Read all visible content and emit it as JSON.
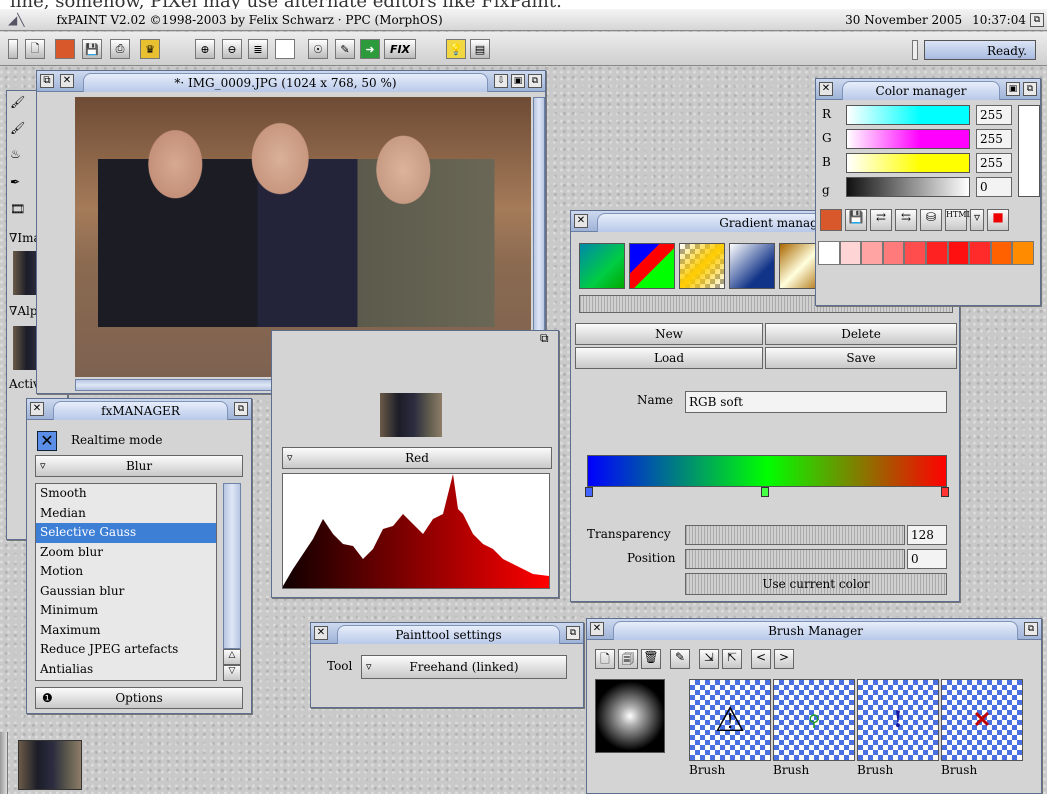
{
  "top_cut_text": "line, somehow, PiXel may use alternate editors like FixPaint.",
  "titlebar": {
    "title": "fxPAINT V2.02 ©1998-2003 by Felix Schwarz · PPC (MorphOS)",
    "date": "30 November 2005",
    "time": "10:37:04"
  },
  "toolbar": {
    "fix_label": "FIX",
    "status": "Ready."
  },
  "image_window": {
    "title": "*· IMG_0009.JPG (1024 x 768, 50 %)"
  },
  "left_tools": {
    "image_label": "∇Image",
    "alpha_label": "∇Alpha",
    "active_label": "Active"
  },
  "fxmanager": {
    "title": "fxMANAGER",
    "realtime_label": "Realtime mode",
    "category": "Blur",
    "effects": [
      "Smooth",
      "Median",
      "Selective Gauss",
      "Zoom blur",
      "Motion",
      "Gaussian blur",
      "Minimum",
      "Maximum",
      "Reduce JPEG artefacts",
      "Antialias"
    ],
    "selected_index": 2,
    "options_label": "Options"
  },
  "histogram_window": {
    "channel": "Red"
  },
  "color_manager": {
    "title": "Color manager",
    "channels": [
      {
        "label": "R",
        "value": "255",
        "color": "#00ffff"
      },
      {
        "label": "G",
        "value": "255",
        "color": "#ff00ff"
      },
      {
        "label": "B",
        "value": "255",
        "color": "#ffff00"
      },
      {
        "label": "g",
        "value": "0",
        "color": "#222222"
      }
    ],
    "palette": [
      "#ffffff",
      "#ffd4d4",
      "#ffa3a3",
      "#ff7b7b",
      "#ff4d4d",
      "#ff2222",
      "#ff1010",
      "#ff2a2a",
      "#ff6000",
      "#ff8c00"
    ]
  },
  "gradient_manager": {
    "title": "Gradient manager",
    "buttons": {
      "new": "New",
      "delete": "Delete",
      "load": "Load",
      "save": "Save"
    },
    "name_label": "Name",
    "name_value": "RGB soft",
    "transparency_label": "Transparency",
    "transparency_value": "128",
    "position_label": "Position",
    "position_value": "0",
    "use_color_label": "Use current color"
  },
  "painttool": {
    "title": "Painttool settings",
    "tool_label": "Tool",
    "tool_value": "Freehand (linked)"
  },
  "brush_manager": {
    "title": "Brush Manager",
    "brush_labels": [
      "Brush",
      "Brush",
      "Brush",
      "Brush"
    ]
  }
}
